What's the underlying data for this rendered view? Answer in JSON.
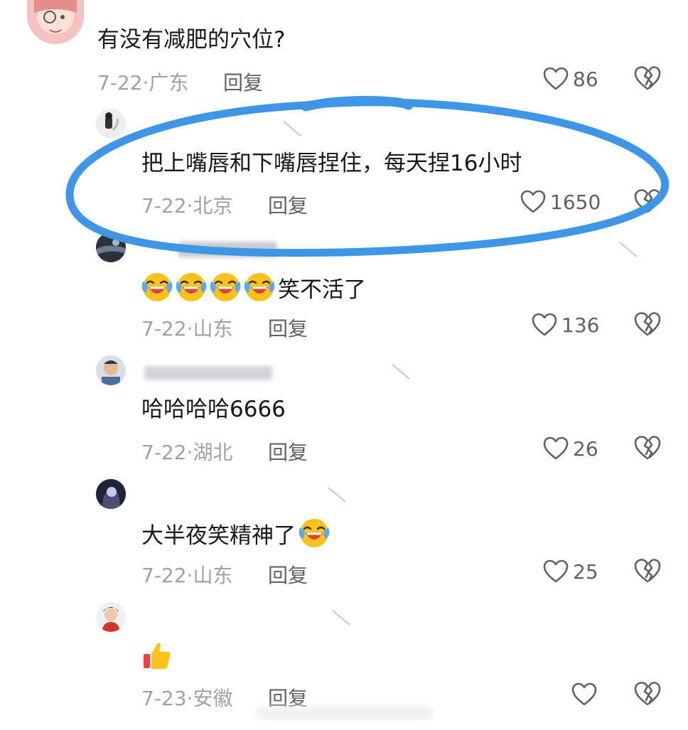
{
  "comments": [
    {
      "text": "有没有减肥的穴位?",
      "date": "7-22·广东",
      "reply": "回复",
      "likes": "86"
    },
    {
      "text": "把上嘴唇和下嘴唇捏住，每天捏16小时",
      "date": "7-22·北京",
      "reply": "回复",
      "likes": "1650"
    },
    {
      "text": "笑不活了",
      "date": "7-22·山东",
      "reply": "回复",
      "likes": "136"
    },
    {
      "text": "哈哈哈哈6666",
      "date": "7-22·湖北",
      "reply": "回复",
      "likes": "26"
    },
    {
      "text": "大半夜笑精神了",
      "date": "7-22·山东",
      "reply": "回复",
      "likes": "25"
    },
    {
      "text": "",
      "date": "7-23·安徽",
      "reply": "回复",
      "likes": ""
    }
  ],
  "colors": {
    "annotation_circle": "#3f95e6",
    "meta_gray": "#9fa1a8",
    "text_dark": "#161823"
  },
  "icons": {
    "like": "heart-outline-icon",
    "dislike": "broken-heart-icon",
    "emoji_laugh": "tears-of-joy-emoji",
    "emoji_thumb": "thumbs-up-emoji"
  }
}
